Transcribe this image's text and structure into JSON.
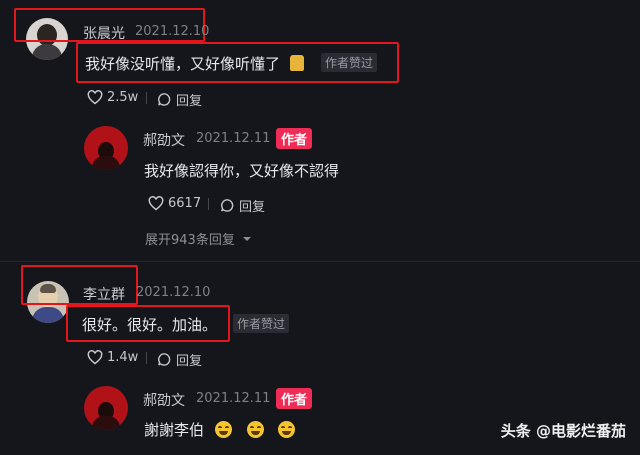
{
  "comments": [
    {
      "user": "张晨光",
      "date": "2021.12.10",
      "text": "我好像没听懂，又好像听懂了",
      "badge": "作者赞过",
      "likes": "2.5w",
      "reply_label": "回复",
      "reply": {
        "user": "郝劭文",
        "date": "2021.12.11",
        "author_tag": "作者",
        "text": "我好像認得你，又好像不認得",
        "likes": "6617",
        "reply_label": "回复",
        "expand": "展开943条回复"
      }
    },
    {
      "user": "李立群",
      "date": "2021.12.10",
      "text": "很好。很好。加油。",
      "badge": "作者赞过",
      "likes": "1.4w",
      "reply_label": "回复",
      "reply": {
        "user": "郝劭文",
        "date": "2021.12.11",
        "author_tag": "作者",
        "text": "謝謝李伯"
      }
    }
  ],
  "watermark": "头条 @电影烂番茄",
  "colors": {
    "background": "#15161b",
    "highlight_box": "#e3161b",
    "author_tag": "#ee2c55"
  },
  "icons": [
    "heart-icon",
    "comment-icon",
    "chevron-down-icon",
    "grin-emoji-icon",
    "folded-hands-emoji-icon"
  ]
}
